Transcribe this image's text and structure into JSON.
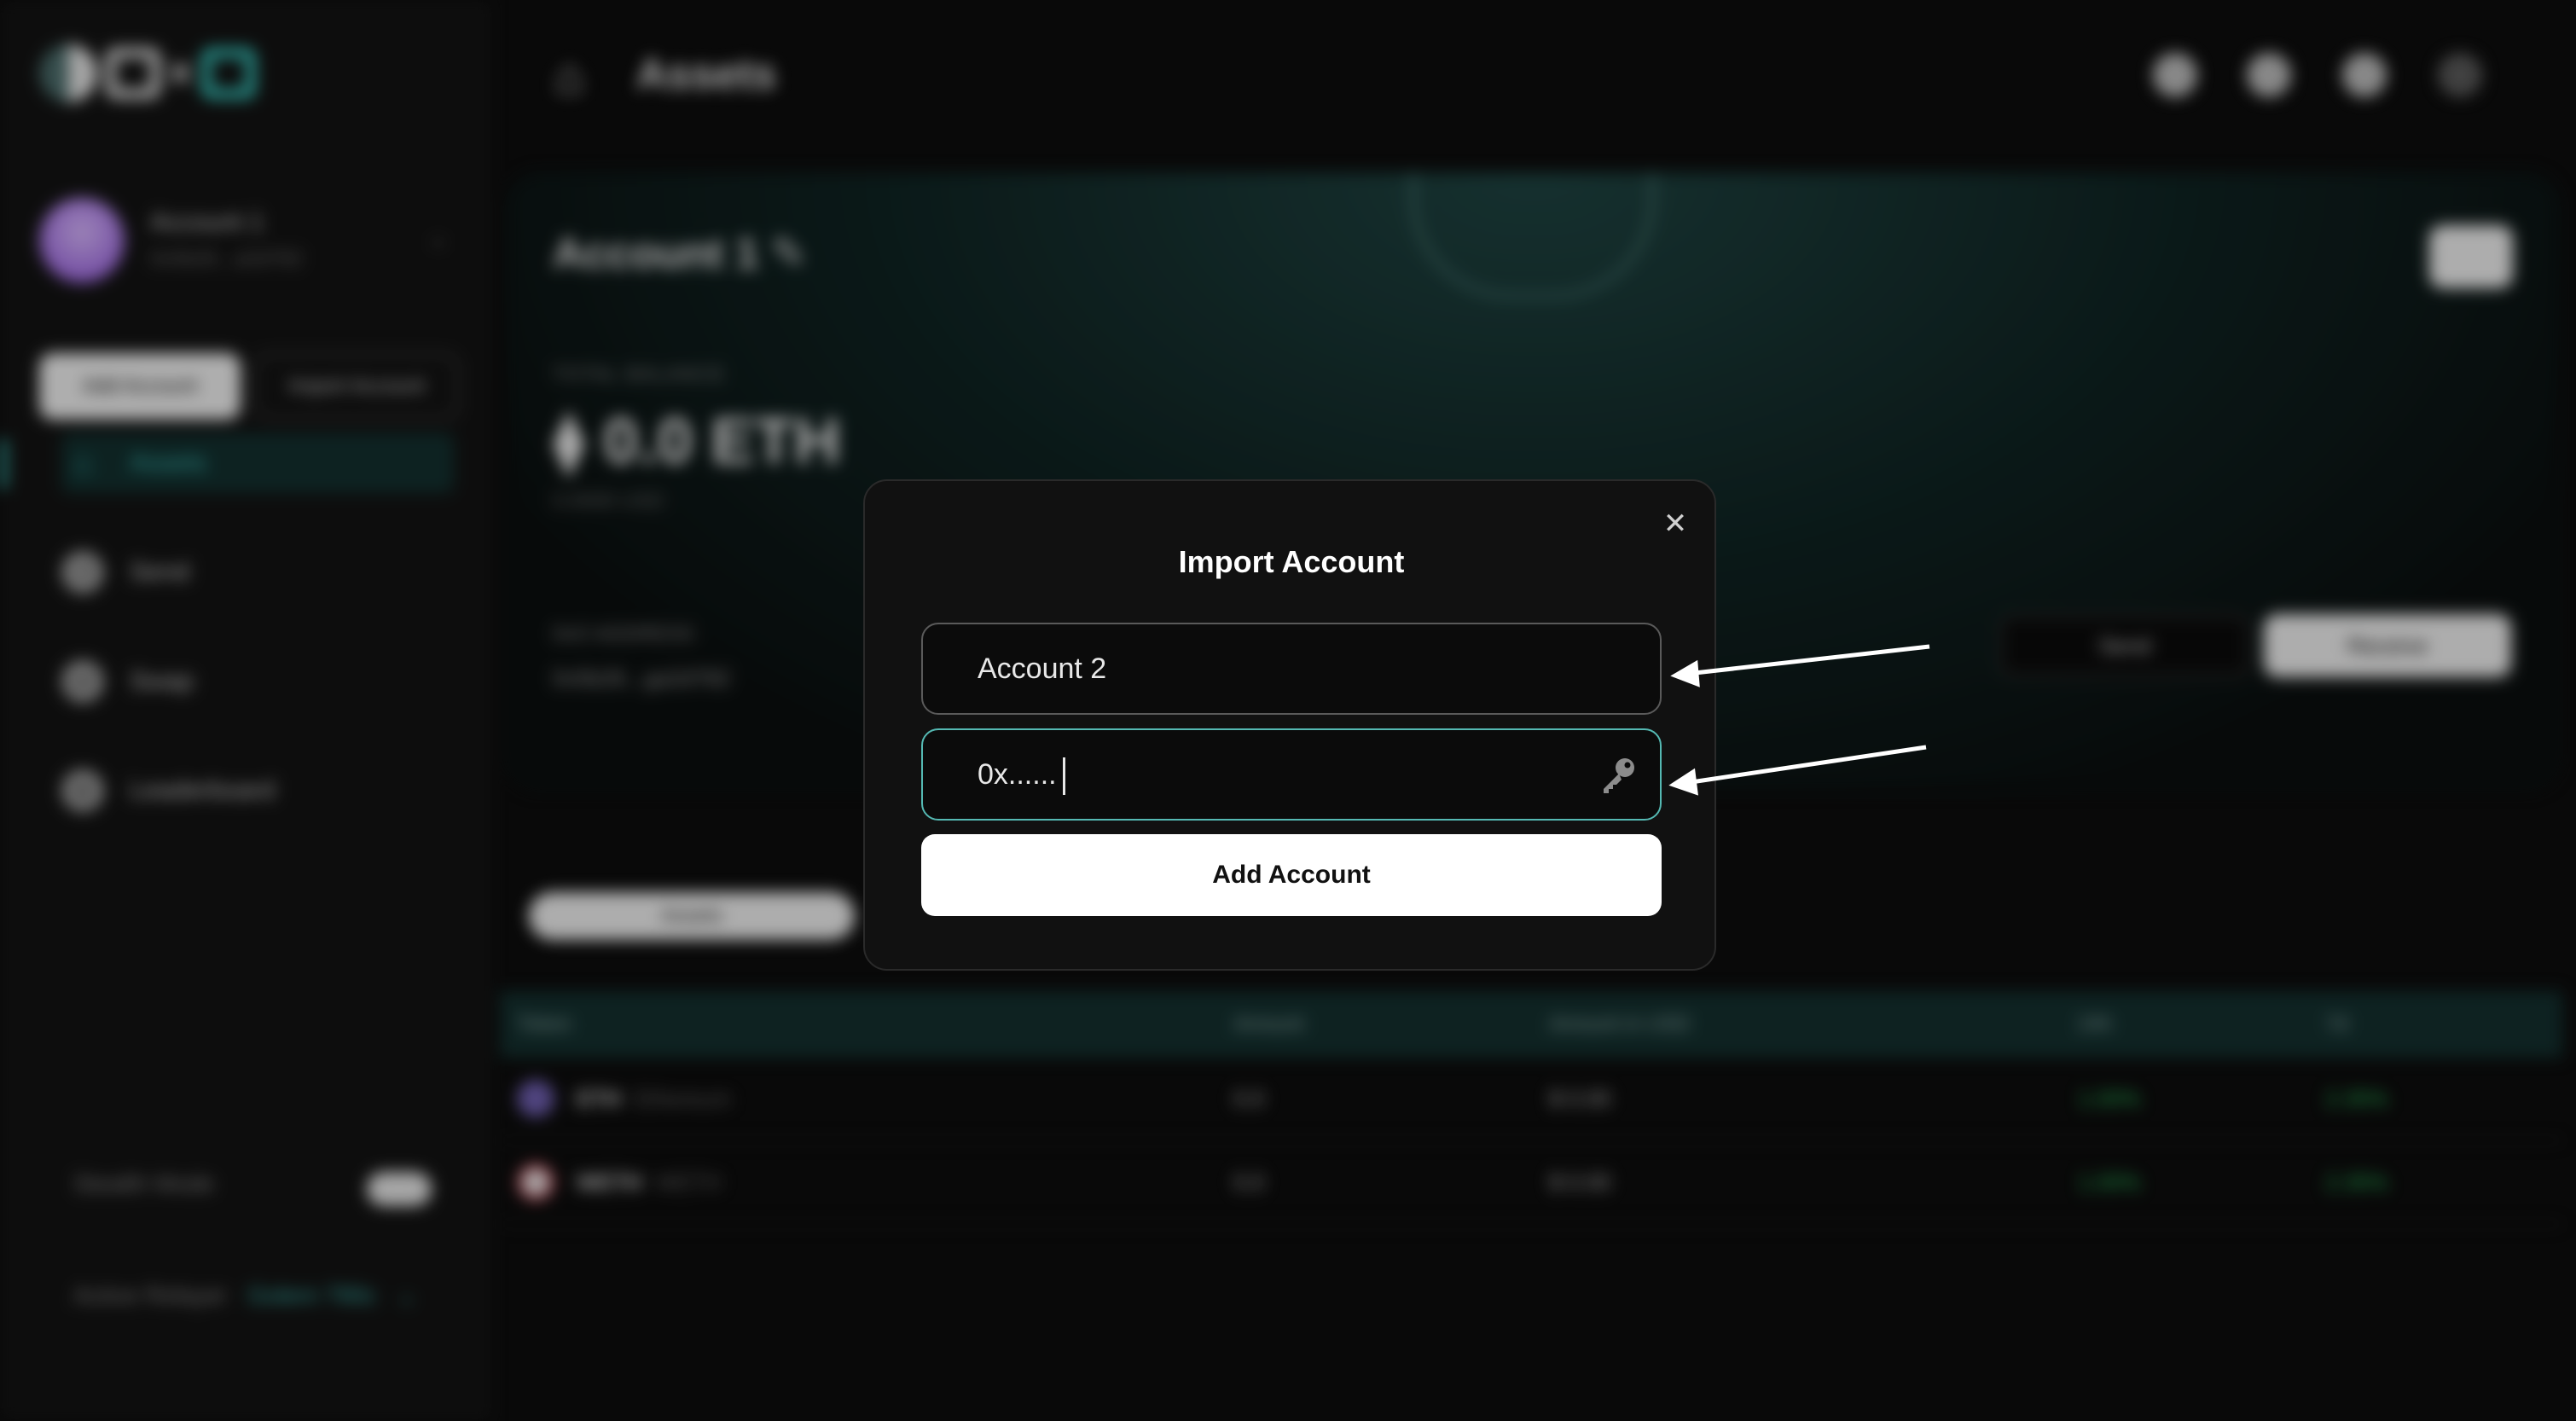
{
  "sidebar": {
    "account": {
      "name": "Account 1",
      "address": "0x5b26...a2d782"
    },
    "add_account": "Add Account",
    "import_account": "Import Account",
    "nav": [
      {
        "label": "Assets",
        "icon": "home-icon"
      },
      {
        "label": "Send",
        "icon": "send-icon"
      },
      {
        "label": "Swap",
        "icon": "swap-icon"
      },
      {
        "label": "Leaderboard",
        "icon": "trophy-icon"
      }
    ],
    "stealth_mode": "Stealth Mode",
    "active_relayer_label": "Active Relayer",
    "active_relayer_value": "Golem 790c"
  },
  "topbar": {
    "title": "Assets"
  },
  "hero": {
    "account_name": "Account 1",
    "total_balance_label": "TOTAL BALANCE",
    "balance": "0.0 ETH",
    "balance_usd": "0.0000 USD",
    "address_label": "0xO ADDRESS",
    "address": "0x5b26...ga2d782",
    "send": "Send",
    "receive": "Receive"
  },
  "tabs": {
    "assets": "Assets"
  },
  "table": {
    "headers": [
      "Token",
      "Amount",
      "Amount in USD",
      "24h",
      "7d"
    ],
    "rows": [
      {
        "symbol": "ETH",
        "name": "Ethereum",
        "amount": "0.0",
        "usd": "$ 0.00",
        "d1": "1.00%",
        "d7": "2.35%"
      },
      {
        "symbol": "WETH",
        "name": "WETH",
        "amount": "0.0",
        "usd": "$ 0.00",
        "d1": "1.00%",
        "d7": "2.35%"
      }
    ]
  },
  "modal": {
    "title": "Import Account",
    "name_value": "Account 2",
    "key_value": "0x......",
    "add_button": "Add Account"
  },
  "colors": {
    "accent": "#3ab9b3",
    "positive": "#27c25c",
    "background": "#0d0d0d"
  }
}
